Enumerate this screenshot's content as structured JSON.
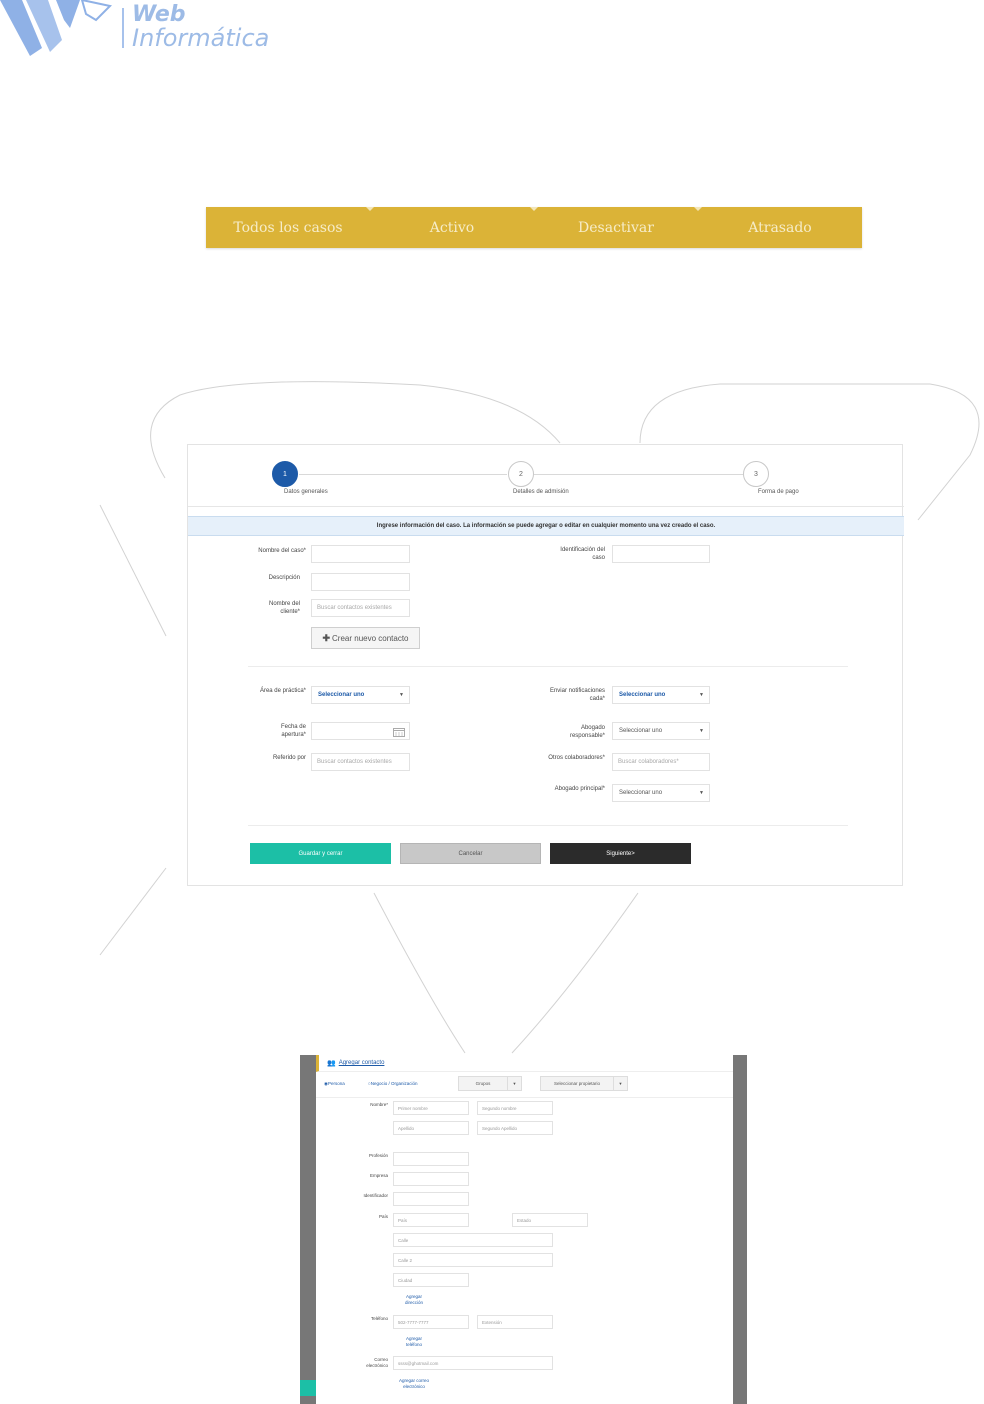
{
  "logo": {
    "line1": "Web",
    "line2": "Informática"
  },
  "tabs": [
    "Todos los casos",
    "Activo",
    "Desactivar",
    "Atrasado"
  ],
  "stepper": [
    {
      "num": "1",
      "label": "Datos generales"
    },
    {
      "num": "2",
      "label": "Detalles de admisión"
    },
    {
      "num": "3",
      "label": "Forma de pago"
    }
  ],
  "info_message": "Ingrese información del caso. La información se puede agregar o editar en cualquier momento una vez creado el caso.",
  "form": {
    "case_name_label": "Nombre del caso*",
    "case_id_label": "Identificación del caso",
    "description_label": "Descripción",
    "client_name_label": "Nombre del cliente*",
    "client_placeholder": "Buscar contactos existentes",
    "new_contact_button": "Crear nuevo contacto",
    "practice_area_label": "Área de práctica*",
    "practice_area_value": "Seleccionar uno",
    "notify_label": "Enviar notificaciones cada*",
    "notify_value": "Seleccionar uno",
    "open_date_label": "Fecha de apertura*",
    "responsible_label": "Abogado responsable*",
    "responsible_value": "Seleccionar uno",
    "referred_label": "Referido por",
    "referred_placeholder": "Buscar contactos existentes",
    "collaborators_label": "Otros colaboradores*",
    "collaborators_placeholder": "Buscar colaboradores*",
    "lead_label": "Abogado principal*",
    "lead_value": "Seleccionar uno"
  },
  "buttons": {
    "save": "Guardar y cerrar",
    "cancel": "Cancelar",
    "next": "Siguiente>"
  },
  "colors": {
    "gold": "#dbb337",
    "teal": "#1cbfa6",
    "blue": "#1d5aa8",
    "dark": "#2b2b2b",
    "gray": "#c8c8c8"
  },
  "contact_modal": {
    "title": "Agregar contacto",
    "type_person": "Persona",
    "type_business": "Negocio / Organización",
    "groups": "Grupos",
    "owner": "Seleccionar propietario",
    "name_label": "Nombre*",
    "first_name": "Primer nombre",
    "middle_name": "Segundo nombre",
    "last_name": "Apellido",
    "second_last_name": "Segundo Apellido",
    "profession_label": "Profesión",
    "company_label": "Empresa",
    "identifier_label": "Identificador",
    "country_label": "País",
    "country_placeholder": "País",
    "state_placeholder": "Estado",
    "street_placeholder": "Calle",
    "street2_placeholder": "Calle 2",
    "city_placeholder": "Ciudad",
    "add_address": "Agregar dirección",
    "phone_label": "Teléfono",
    "phone_value": "502-7777-7777",
    "extension_placeholder": "Extensión",
    "add_phone": "Agregar teléfono",
    "email_label": "Correo electrónico",
    "email_value": "ssss@ghotmail.com",
    "add_email": "Agregar correo electrónico"
  }
}
